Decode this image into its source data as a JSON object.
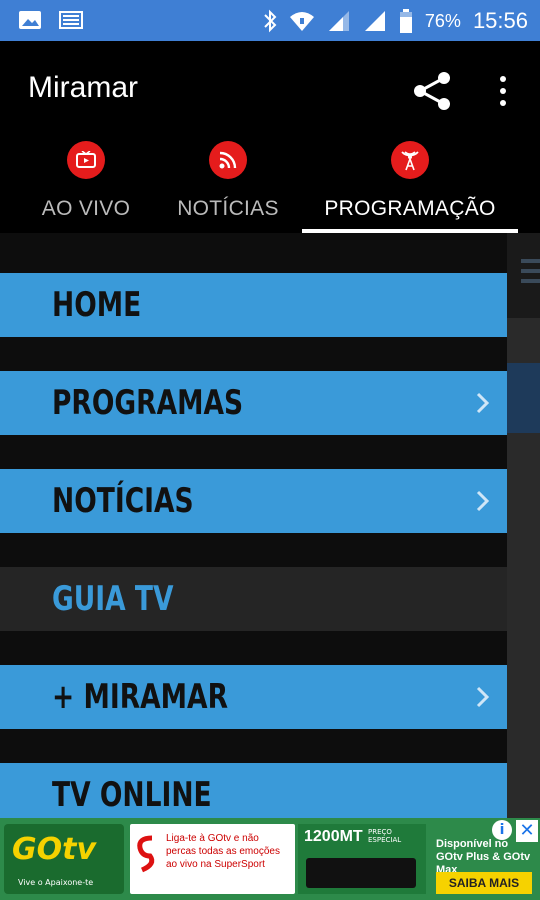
{
  "status_bar": {
    "battery": "76%",
    "time": "15:56",
    "icons": [
      "image-icon",
      "keyboard-icon",
      "bluetooth-icon",
      "wifi-icon",
      "signal-icon",
      "signal-icon",
      "battery-icon"
    ]
  },
  "app_bar": {
    "title": "Miramar",
    "actions": [
      "share-icon",
      "more-vert-icon"
    ]
  },
  "tabs": [
    {
      "label": "AO VIVO",
      "icon": "live-tv-icon",
      "active": false
    },
    {
      "label": "NOTÍCIAS",
      "icon": "rss-icon",
      "active": false
    },
    {
      "label": "PROGRAMAÇÃO",
      "icon": "antenna-icon",
      "active": true
    }
  ],
  "drawer": {
    "items": [
      {
        "label": "HOME",
        "chevron": false,
        "active": false
      },
      {
        "label": "PROGRAMAS",
        "chevron": true,
        "active": false
      },
      {
        "label": "NOTÍCIAS",
        "chevron": true,
        "active": false
      },
      {
        "label": "GUIA TV",
        "chevron": false,
        "active": true
      },
      {
        "label": "+ MIRAMAR",
        "chevron": true,
        "active": false
      },
      {
        "label": "TV ONLINE",
        "chevron": false,
        "active": false
      }
    ]
  },
  "ad": {
    "brand": "GOtv",
    "tagline": "Vive o Apaixone-te",
    "message": "Liga-te à GOtv e não percas todas as emoções ao vivo na SuperSport",
    "price": "1200MT",
    "price_note": "PREÇO ESPECIAL",
    "offer": "Disponível no GOtv Plus & GOtv Max",
    "cta": "SAIBA MAIS",
    "info": "i",
    "close": "✕"
  },
  "colors": {
    "status_bar": "#3f7fd4",
    "menu_item": "#3a9ad9",
    "menu_item_active": "#252525",
    "tab_icon_bg": "#e51c1c",
    "ad_green": "#2d8a4a",
    "cta_yellow": "#f6d200"
  }
}
